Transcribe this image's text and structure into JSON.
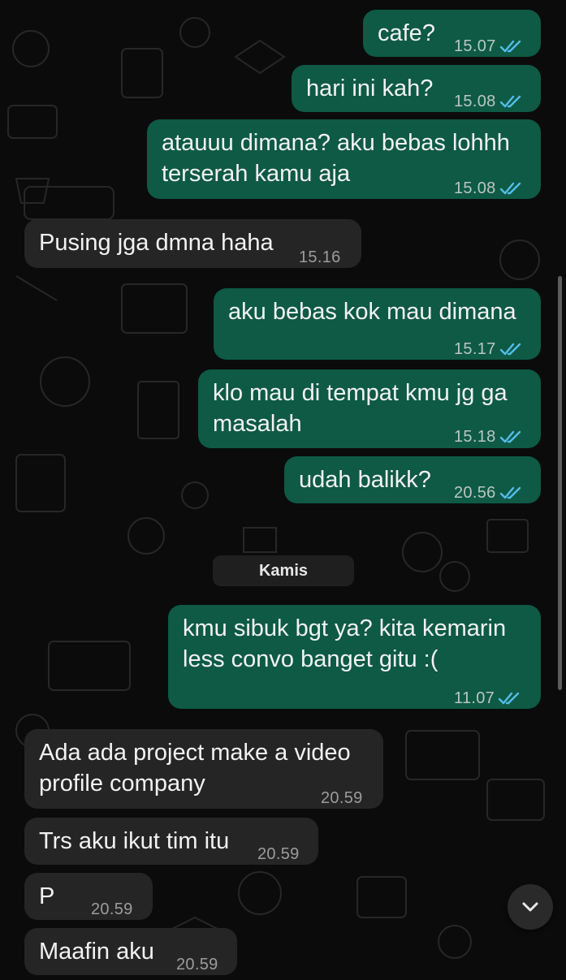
{
  "colors": {
    "background": "#0b0b0b",
    "outgoing_bubble": "#0e5a44",
    "incoming_bubble": "#252525",
    "read_ticks": "#53bdeb"
  },
  "messages": [
    {
      "direction": "outgoing",
      "text_lines": [
        "cafe?"
      ],
      "time": "15.07",
      "status": "read"
    },
    {
      "direction": "outgoing",
      "text_lines": [
        "hari ini kah?"
      ],
      "time": "15.08",
      "status": "read"
    },
    {
      "direction": "outgoing",
      "text_lines": [
        "atauuu dimana? aku bebas lohhh",
        "terserah kamu aja"
      ],
      "time": "15.08",
      "status": "read"
    },
    {
      "direction": "incoming",
      "text_lines": [
        "Pusing jga dmna haha"
      ],
      "time": "15.16"
    },
    {
      "direction": "outgoing",
      "text_lines": [
        "aku bebas kok mau dimana"
      ],
      "time": "15.17",
      "status": "read"
    },
    {
      "direction": "outgoing",
      "text_lines": [
        "klo mau di tempat kmu jg ga",
        "masalah"
      ],
      "time": "15.18",
      "status": "read"
    },
    {
      "direction": "outgoing",
      "text_lines": [
        "udah balikk?"
      ],
      "time": "20.56",
      "status": "read"
    },
    {
      "direction": "outgoing",
      "text_lines": [
        "kmu sibuk bgt ya? kita kemarin",
        "less convo banget gitu :("
      ],
      "time": "11.07",
      "status": "read"
    },
    {
      "direction": "incoming",
      "text_lines": [
        "Ada ada project make a video",
        "profile company"
      ],
      "time": "20.59"
    },
    {
      "direction": "incoming",
      "text_lines": [
        "Trs aku ikut tim itu"
      ],
      "time": "20.59"
    },
    {
      "direction": "incoming",
      "text_lines": [
        "P"
      ],
      "time": "20.59",
      "redacted": true
    },
    {
      "direction": "incoming",
      "text_lines": [
        "Maafin aku"
      ],
      "time": "20.59"
    }
  ],
  "date_separator": "Kamis",
  "icons": {
    "read_receipt": "double-check-icon",
    "scroll_down": "chevron-down-icon"
  }
}
